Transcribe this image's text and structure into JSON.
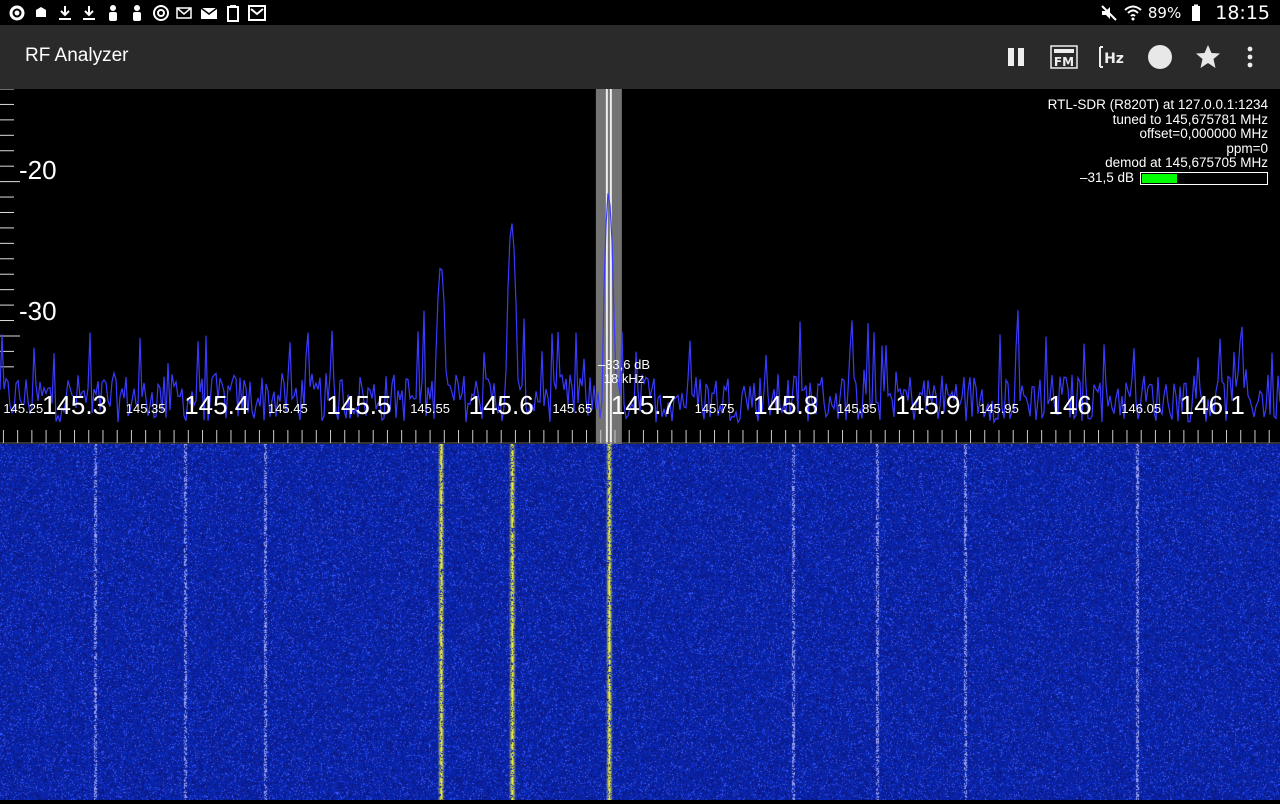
{
  "status_bar": {
    "battery": "89%",
    "time": "18:15",
    "left_icons": [
      "settings-gear-icon",
      "security-icon",
      "download-icon",
      "download-icon",
      "figure-icon",
      "figure-icon",
      "timer-icon",
      "email-icon",
      "mail-icon",
      "clipboard-icon",
      "mail-box-icon"
    ],
    "right_icons": [
      "mute-icon",
      "wifi-icon",
      "battery-icon"
    ]
  },
  "app_bar": {
    "title": "RF Analyzer",
    "actions": [
      {
        "name": "pause-icon",
        "label": "pause"
      },
      {
        "name": "narrow-fm-icon",
        "label": "narrow FM"
      },
      {
        "name": "hz-icon",
        "label": "Hz"
      },
      {
        "name": "record-icon",
        "label": "record"
      },
      {
        "name": "favorite-icon",
        "label": "bookmarks"
      },
      {
        "name": "overflow-menu-icon",
        "label": "more"
      }
    ]
  },
  "info": {
    "line1": "RTL-SDR (R820T) at 127.0.0.1:1234",
    "line2": "tuned to 145,675781 MHz",
    "line3": "offset=0,000000 MHz",
    "line4": "ppm=0",
    "line5": "demod at 145,675705 MHz",
    "db_label": "–31,5 dB",
    "db_level": 0.28
  },
  "spectrum": {
    "y_labels": [
      "-20",
      "-30"
    ],
    "y_label_values": [
      -20,
      -30
    ],
    "freq_major": [
      "145.3",
      "145.4",
      "145.5",
      "145.6",
      "145.7",
      "145.8",
      "145.9",
      "146",
      "146.1"
    ],
    "freq_major_values": [
      145.3,
      145.4,
      145.5,
      145.6,
      145.7,
      145.8,
      145.9,
      146.0,
      146.1
    ],
    "freq_minor": [
      "145.25",
      "145.35",
      "145.45",
      "145.55",
      "145.65",
      "145.75",
      "145.85",
      "145.95",
      "146.05"
    ],
    "freq_minor_values": [
      145.25,
      145.35,
      145.45,
      145.55,
      145.65,
      145.75,
      145.85,
      145.95,
      146.05
    ],
    "freq_start": 145.2476,
    "freq_end": 146.1476,
    "db_top": -14.0,
    "db_bottom": -37.0,
    "marker_db": "–33,6 dB",
    "marker_bw": "18 kHz",
    "channel_freq": 145.6757,
    "channel_width_mhz": 0.018,
    "peaks": [
      {
        "freq": 145.5575,
        "db": -25.2
      },
      {
        "freq": 145.6075,
        "db": -23.0
      },
      {
        "freq": 145.6757,
        "db": -21.0
      }
    ]
  },
  "colors": {
    "accent_line": "#3a3aff",
    "waterfall_bg": "#0e1b8a",
    "waterfall_peak": "#ffff30",
    "level_fill": "#00ff00"
  }
}
